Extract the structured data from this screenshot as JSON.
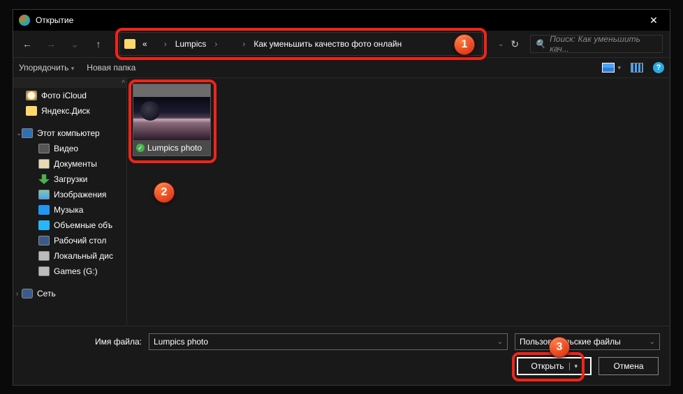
{
  "title": "Открытие",
  "nav": {
    "back": "←",
    "fwd": "→",
    "up": "↑"
  },
  "breadcrumb": {
    "items": [
      "«",
      "",
      "Lumpics",
      "",
      "",
      "Как уменьшить качество фото онлайн"
    ],
    "blurred": [
      false,
      true,
      false,
      true,
      true,
      false
    ]
  },
  "search": {
    "placeholder": "Поиск: Как уменьшить кач..."
  },
  "toolbar": {
    "organize": "Упорядочить",
    "newfolder": "Новая папка",
    "help": "?"
  },
  "sidebar": {
    "icloud": "Фото iCloud",
    "ydisk": "Яндекс.Диск",
    "pc": "Этот компьютер",
    "video": "Видео",
    "docs": "Документы",
    "dl": "Загрузки",
    "img": "Изображения",
    "music": "Музыка",
    "obj": "Объемные объ",
    "desk": "Рабочий стол",
    "ldisk": "Локальный дис",
    "gdisk": "Games (G:)",
    "net": "Сеть"
  },
  "thumb": {
    "label": "Lumpics photo"
  },
  "footer": {
    "file_label": "Имя файла:",
    "file_value": "Lumpics photo",
    "type_value": "Пользовательские файлы",
    "open": "Открыть",
    "cancel": "Отмена"
  },
  "badges": {
    "b1": "1",
    "b2": "2",
    "b3": "3"
  }
}
